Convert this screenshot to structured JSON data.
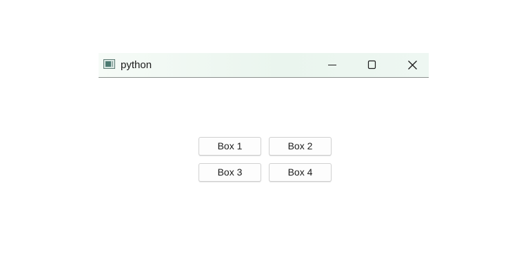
{
  "window": {
    "title": "python",
    "icon": "app-window-icon",
    "controls": {
      "minimize_icon": "minimize-icon",
      "maximize_icon": "maximize-icon",
      "close_icon": "close-icon"
    }
  },
  "buttons": [
    {
      "label": "Box 1"
    },
    {
      "label": "Box 2"
    },
    {
      "label": "Box 3"
    },
    {
      "label": "Box 4"
    }
  ],
  "colors": {
    "titlebar_bg": "#eaf5ee",
    "button_bg": "#fdfdfd",
    "button_border": "#d0d0d0",
    "text": "#1a1a1a"
  }
}
